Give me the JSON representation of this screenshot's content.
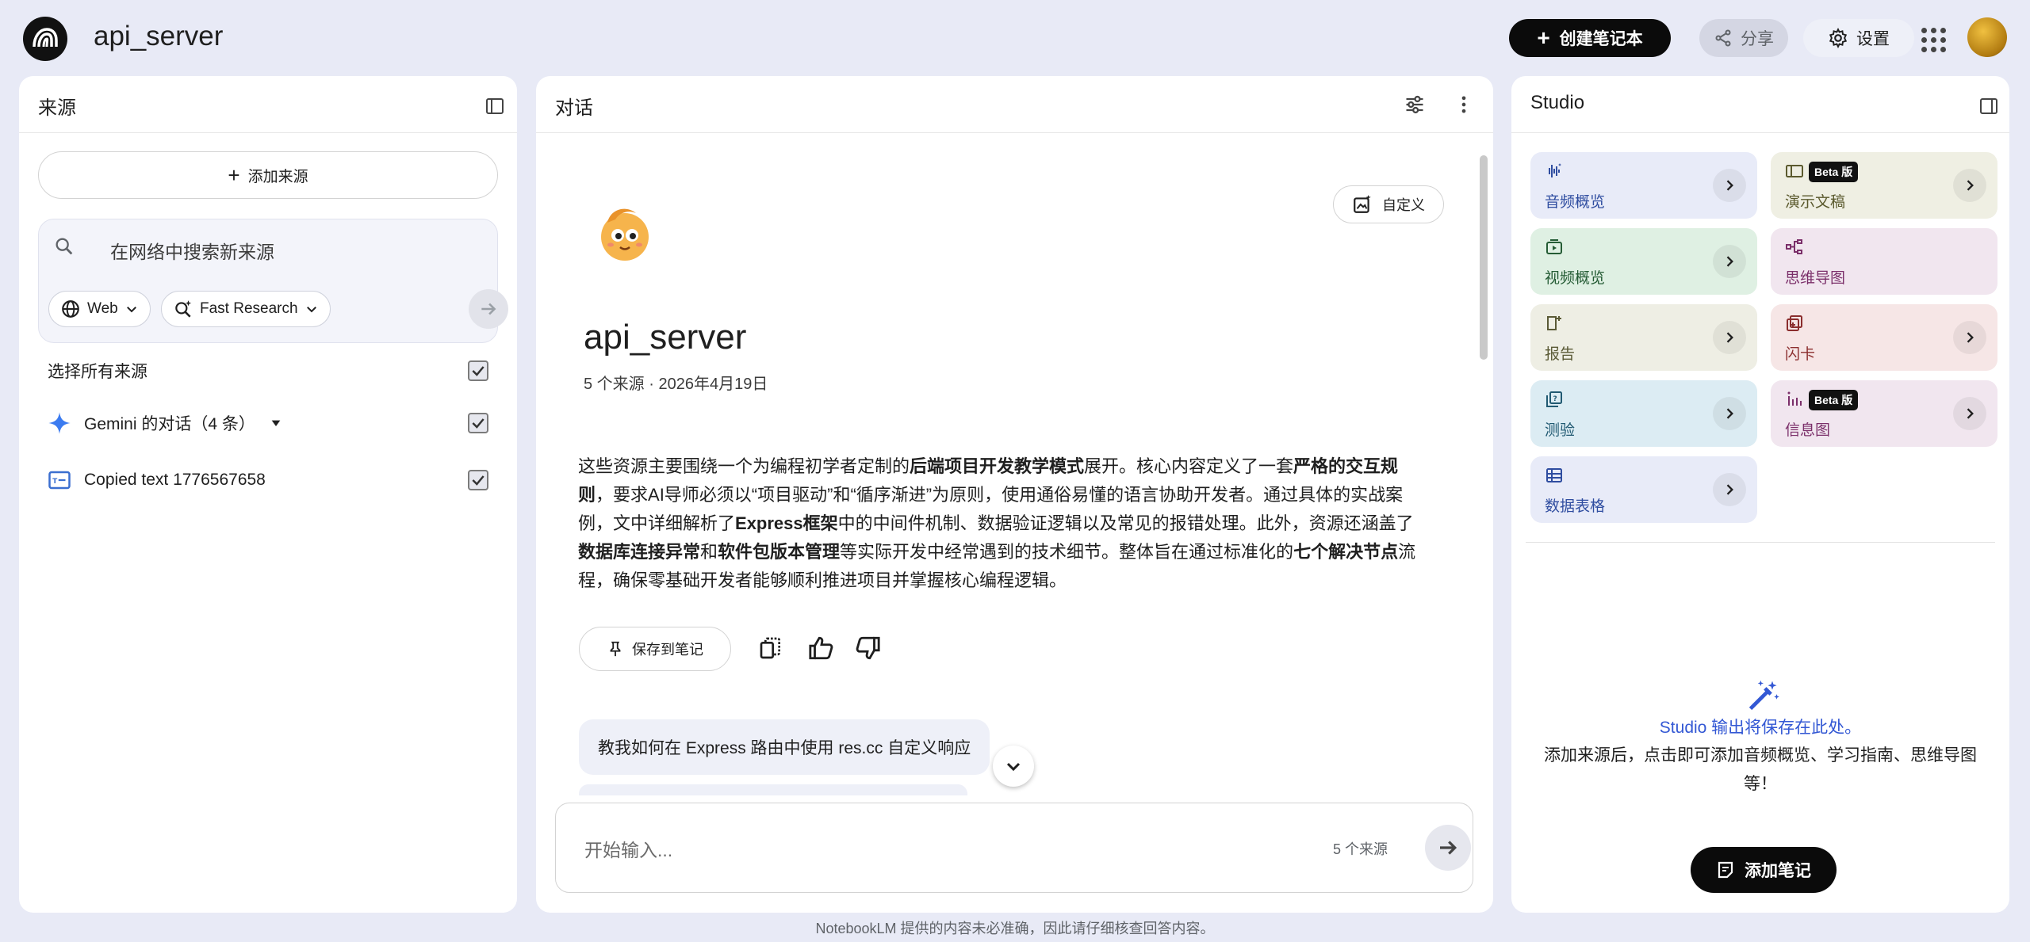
{
  "header": {
    "title": "api_server",
    "create_label": "创建笔记本",
    "share_label": "分享",
    "settings_label": "设置"
  },
  "sources": {
    "title": "来源",
    "add_label": "添加来源",
    "search_placeholder": "在网络中搜索新来源",
    "web_label": "Web",
    "research_label": "Fast Research",
    "select_all_label": "选择所有来源",
    "items": [
      {
        "label": "Gemini 的对话（4 条）",
        "checked": true
      },
      {
        "label": "Copied text 1776567658",
        "checked": true
      }
    ]
  },
  "chat": {
    "title": "对话",
    "customize_label": "自定义",
    "notebook_title": "api_server",
    "meta": "5 个来源 · 2026年4月19日",
    "summary": [
      {
        "t": "这些资源主要围绕一个为编程初学者定制的",
        "b": false
      },
      {
        "t": "后端项目开发教学模式",
        "b": true
      },
      {
        "t": "展开。核心内容定义了一套",
        "b": false
      },
      {
        "t": "严格的交互规则",
        "b": true
      },
      {
        "t": "，要求AI导师必须以“项目驱动”和“循序渐进”为原则，使用通俗易懂的语言协助开发者。通过具体的实战案例，文中详细解析了",
        "b": false
      },
      {
        "t": "Express框架",
        "b": true
      },
      {
        "t": "中的中间件机制、数据验证逻辑以及常见的报错处理。此外，资源还涵盖了",
        "b": false
      },
      {
        "t": "数据库连接异常",
        "b": true
      },
      {
        "t": "和",
        "b": false
      },
      {
        "t": "软件包版本管理",
        "b": true
      },
      {
        "t": "等实际开发中经常遇到的技术细节。整体旨在通过标准化的",
        "b": false
      },
      {
        "t": "七个解决节点",
        "b": true
      },
      {
        "t": "流程，确保零基础开发者能够顺利推进项目并掌握核心编程逻辑。",
        "b": false
      }
    ],
    "save_note_label": "保存到笔记",
    "user_message": "教我如何在 Express 路由中使用 res.cc 自定义响应",
    "input_placeholder": "开始输入...",
    "source_count": "5 个来源"
  },
  "studio": {
    "title": "Studio",
    "tiles": [
      {
        "label": "音频概览",
        "bg": "#e8ebf8",
        "fg": "#2f4da0",
        "icon": "audio-waveform-icon",
        "beta": "",
        "arrow": true
      },
      {
        "label": "演示文稿",
        "bg": "#efefe3",
        "fg": "#5b5a2e",
        "icon": "slides-icon",
        "beta": "Beta 版",
        "arrow": true
      },
      {
        "label": "视频概览",
        "bg": "#dff0e3",
        "fg": "#255c35",
        "icon": "video-icon",
        "beta": "",
        "arrow": true
      },
      {
        "label": "思维导图",
        "bg": "#f1e6ef",
        "fg": "#7b2f6a",
        "icon": "mind-map-icon",
        "beta": "",
        "arrow": false
      },
      {
        "label": "报告",
        "bg": "#eeeee4",
        "fg": "#5a5a36",
        "icon": "report-icon",
        "beta": "",
        "arrow": true
      },
      {
        "label": "闪卡",
        "bg": "#f6e6e6",
        "fg": "#8b2e2e",
        "icon": "flashcards-icon",
        "beta": "",
        "arrow": true
      },
      {
        "label": "测验",
        "bg": "#dcecf3",
        "fg": "#215a72",
        "icon": "quiz-icon",
        "beta": "",
        "arrow": true
      },
      {
        "label": "信息图",
        "bg": "#f1e6ef",
        "fg": "#7b2f6a",
        "icon": "infographic-icon",
        "beta": "Beta 版",
        "arrow": true
      },
      {
        "label": "数据表格",
        "bg": "#e8ebf8",
        "fg": "#2f4da0",
        "icon": "data-table-icon",
        "beta": "",
        "arrow": true
      }
    ],
    "empty_title": "Studio 输出将保存在此处。",
    "empty_desc": "添加来源后，点击即可添加音频概览、学习指南、思维导图等！",
    "add_note_label": "添加笔记"
  },
  "footer": "NotebookLM 提供的内容未必准确，因此请仔细核查回答内容。"
}
